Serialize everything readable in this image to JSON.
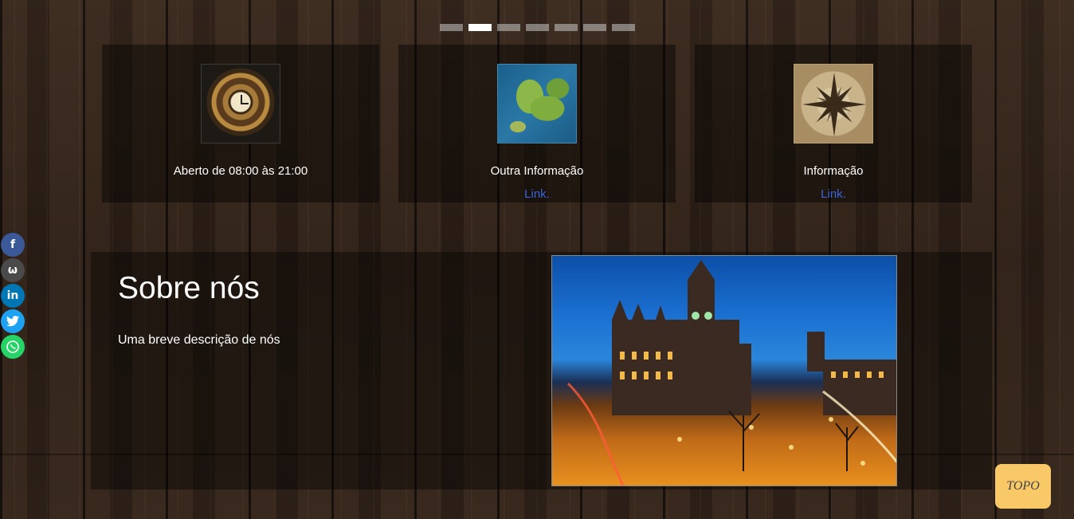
{
  "slider": {
    "indicator_count": 7,
    "active_index": 1
  },
  "cards": [
    {
      "icon": "clock-image",
      "text": "Aberto de 08:00 às 21:00",
      "link": ""
    },
    {
      "icon": "europe-map-image",
      "text": "Outra Informação",
      "link": "Link."
    },
    {
      "icon": "compass-rose-image",
      "text": "Informação",
      "link": "Link."
    }
  ],
  "about": {
    "title": "Sobre nós",
    "description": "Uma breve descrição de nós",
    "image": "city-hall-night-photo"
  },
  "social": [
    {
      "network": "facebook",
      "icon": "facebook-icon",
      "color": "#3b5998"
    },
    {
      "network": "workplace",
      "icon": "workplace-icon",
      "color": "#4a4a4a"
    },
    {
      "network": "linkedin",
      "icon": "linkedin-icon",
      "color": "#0077b5"
    },
    {
      "network": "twitter",
      "icon": "twitter-icon",
      "color": "#1da1f2"
    },
    {
      "network": "whatsapp",
      "icon": "whatsapp-icon",
      "color": "#25d366"
    }
  ],
  "top_button": {
    "label": "TOPO",
    "color": "#f9c968"
  },
  "colors": {
    "link": "#3b64d8"
  }
}
